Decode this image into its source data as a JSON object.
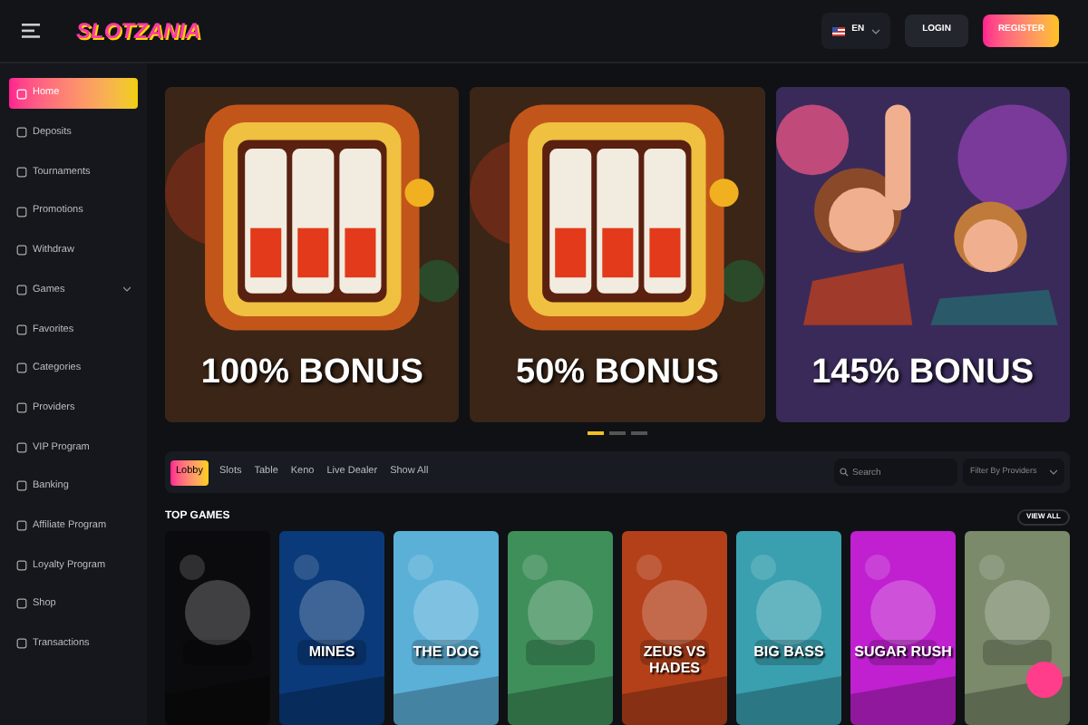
{
  "header": {
    "logo": "SLOTZANIA",
    "language": "EN",
    "login": "LOGIN",
    "register": "REGISTER"
  },
  "sidebar": {
    "items": [
      {
        "label": "Home",
        "selected": true
      },
      {
        "label": "Deposits",
        "selected": false
      },
      {
        "label": "Tournaments",
        "selected": false
      },
      {
        "label": "Promotions",
        "selected": false
      },
      {
        "label": "Withdraw",
        "selected": false
      },
      {
        "label": "Games",
        "selected": false,
        "expandable": true
      },
      {
        "label": "Favorites",
        "selected": false
      },
      {
        "label": "Categories",
        "selected": false
      },
      {
        "label": "Providers",
        "selected": false
      },
      {
        "label": "VIP Program",
        "selected": false
      },
      {
        "label": "Banking",
        "selected": false
      },
      {
        "label": "Affiliate Program",
        "selected": false
      },
      {
        "label": "Loyalty Program",
        "selected": false
      },
      {
        "label": "Shop",
        "selected": false
      },
      {
        "label": "Transactions",
        "selected": false
      }
    ]
  },
  "banners": [
    {
      "kind": "slot",
      "title": "100% BONUS"
    },
    {
      "kind": "slot",
      "title": "50% BONUS"
    },
    {
      "kind": "people",
      "title": "145% BONUS"
    }
  ],
  "carousel_dots": [
    {
      "selected": true
    },
    {
      "selected": false
    },
    {
      "selected": false
    }
  ],
  "filter_tabs": [
    {
      "label": "Lobby",
      "selected": true
    },
    {
      "label": "Slots",
      "selected": false
    },
    {
      "label": "Table",
      "selected": false
    },
    {
      "label": "Keno",
      "selected": false
    },
    {
      "label": "Live Dealer",
      "selected": false
    },
    {
      "label": "Show All",
      "selected": false
    }
  ],
  "search": {
    "placeholder": "Search"
  },
  "provider_filter": {
    "value": "Filter By Providers"
  },
  "top_games": {
    "title": "TOP GAMES",
    "view_all": "VIEW ALL",
    "games": [
      {
        "color": "#0b0b0d"
      },
      {
        "color": "#0a3a7a",
        "title": "MINES"
      },
      {
        "color": "#5bb0d8",
        "title": "THE DOG"
      },
      {
        "color": "#3f8f5a"
      },
      {
        "color": "#b4401a",
        "title": "ZEUS VS HADES"
      },
      {
        "color": "#3aa0b0",
        "title": "BIG BASS"
      },
      {
        "color": "#c020d0",
        "title": "SUGAR RUSH"
      },
      {
        "color": "#7a8a6a"
      }
    ]
  }
}
